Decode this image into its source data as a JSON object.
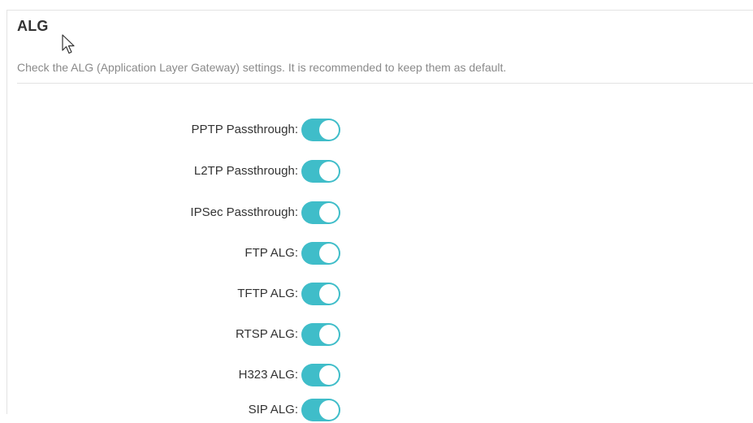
{
  "section": {
    "title": "ALG",
    "description": "Check the ALG (Application Layer Gateway) settings. It is recommended to keep them as default."
  },
  "settings": [
    {
      "label": "PPTP Passthrough:",
      "enabled": true
    },
    {
      "label": "L2TP Passthrough:",
      "enabled": true
    },
    {
      "label": "IPSec Passthrough:",
      "enabled": true
    },
    {
      "label": "FTP ALG:",
      "enabled": true
    },
    {
      "label": "TFTP ALG:",
      "enabled": true
    },
    {
      "label": "RTSP ALG:",
      "enabled": true
    },
    {
      "label": "H323 ALG:",
      "enabled": true
    },
    {
      "label": "SIP ALG:",
      "enabled": true
    }
  ],
  "colors": {
    "toggle_on": "#3fbdc9",
    "title": "#333333",
    "description": "#8a8a8a"
  },
  "icons": {
    "cursor": "mouse-pointer-icon"
  }
}
